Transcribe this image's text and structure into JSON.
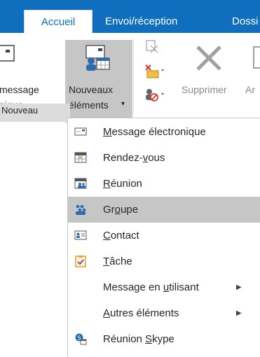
{
  "tabs": [
    {
      "label": "Accueil",
      "active": true
    },
    {
      "label": "Envoi/réception",
      "active": false
    },
    {
      "label": "Dossi",
      "active": false
    }
  ],
  "ribbon": {
    "partial_button_line1": "message",
    "partial_button_line2": "nique",
    "new_items_line1": "Nouveaux",
    "new_items_line2": "éléments",
    "new_items_caret": "▾",
    "delete_label": "Supprimer",
    "partial_next_label": "Ar",
    "group_label": "Nouveau"
  },
  "menu": {
    "items": [
      {
        "pre": "",
        "mn": "M",
        "post": "essage électronique",
        "icon": "email-icon"
      },
      {
        "pre": "Rendez-",
        "mn": "v",
        "post": "ous",
        "icon": "calendar-icon"
      },
      {
        "pre": "",
        "mn": "R",
        "post": "éunion",
        "icon": "meeting-icon"
      },
      {
        "pre": "Gr",
        "mn": "o",
        "post": "upe",
        "icon": "group-icon",
        "highlighted": true
      },
      {
        "pre": "",
        "mn": "C",
        "post": "ontact",
        "icon": "contact-card-icon"
      },
      {
        "pre": "",
        "mn": "T",
        "post": "âche",
        "icon": "task-icon"
      },
      {
        "pre": "Message en ",
        "mn": "u",
        "post": "tilisant",
        "icon": "",
        "submenu": true
      },
      {
        "pre": "",
        "mn": "A",
        "post": "utres éléments",
        "icon": "",
        "submenu": true
      },
      {
        "pre": "Réunion ",
        "mn": "S",
        "post": "kype",
        "icon": "skype-meeting-icon"
      }
    ],
    "submenu_arrow": "▶"
  },
  "colors": {
    "tab_blue": "#106ebe",
    "highlight_gray": "#c6c6c6",
    "icon_blue": "#2b6cb0",
    "task_orange": "#e8a33d",
    "delete_red": "#d9342b"
  }
}
